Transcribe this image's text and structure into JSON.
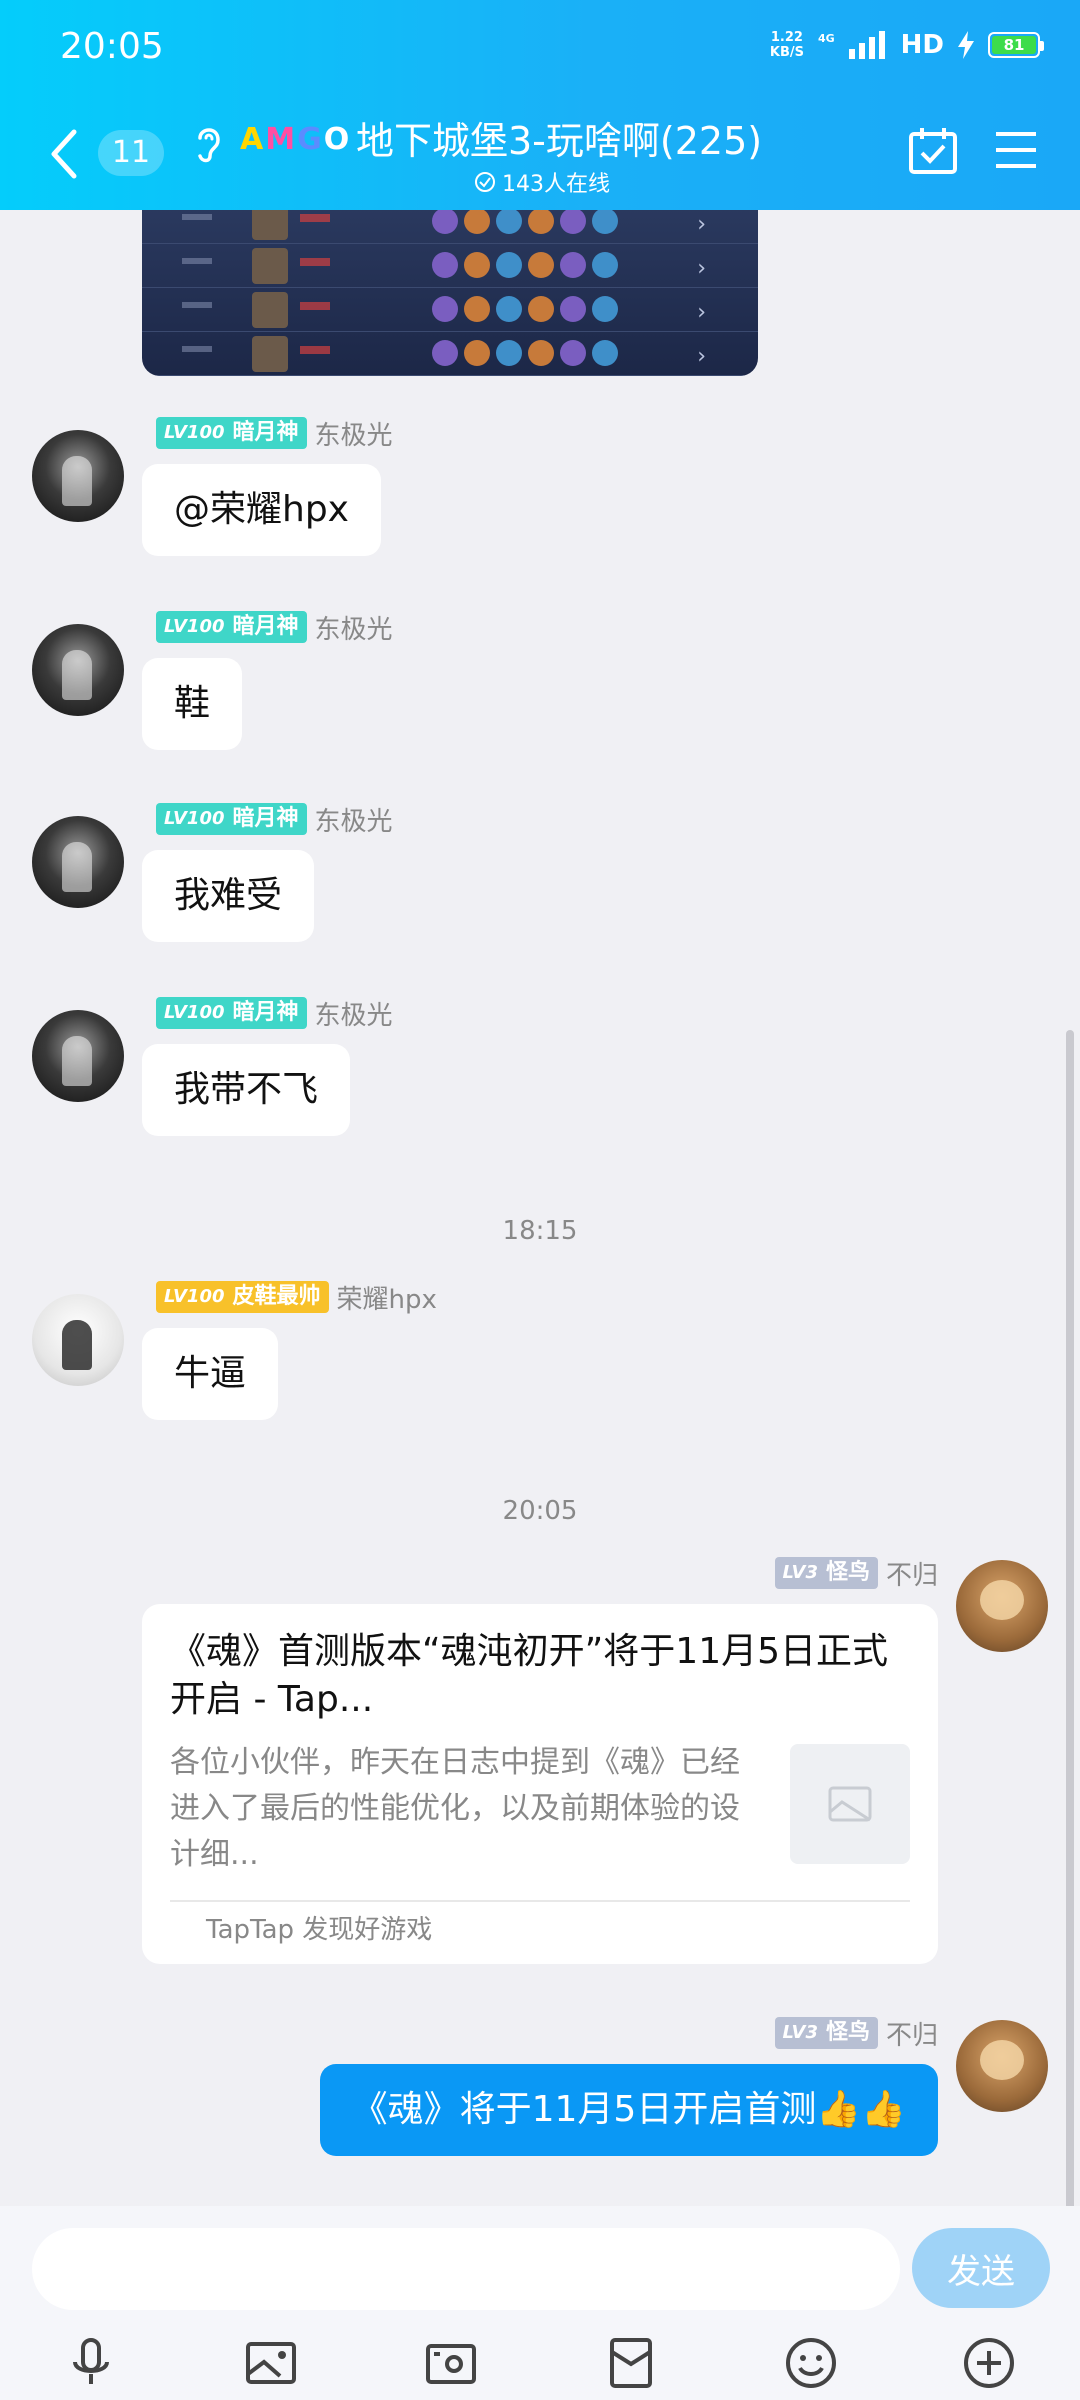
{
  "status_bar": {
    "time": "20:05",
    "net_speed_value": "1.22",
    "net_speed_unit": "KB/S",
    "network": "4G",
    "hd": "HD",
    "battery": "81"
  },
  "header": {
    "unread_count": "11",
    "group_logo": [
      "A",
      "M",
      "G",
      "O"
    ],
    "group_title": "地下城堡3-玩啥啊(225)",
    "online_text": "143人在线"
  },
  "messages": [
    {
      "level": "LV100",
      "title": "暗月神",
      "sender": "东极光",
      "text": "@荣耀hpx"
    },
    {
      "level": "LV100",
      "title": "暗月神",
      "sender": "东极光",
      "text": "鞋"
    },
    {
      "level": "LV100",
      "title": "暗月神",
      "sender": "东极光",
      "text": "我难受"
    },
    {
      "level": "LV100",
      "title": "暗月神",
      "sender": "东极光",
      "text": "我带不飞"
    },
    {
      "level": "LV100",
      "title": "皮鞋最帅",
      "sender": "荣耀hpx",
      "text": "牛逼"
    }
  ],
  "timestamps": [
    "18:15",
    "20:05"
  ],
  "link_card": {
    "level": "LV3",
    "title_tag": "怪鸟",
    "sender": "不归",
    "title": "《魂》首测版本“魂沌初开”将于11月5日正式开启 - Tap...",
    "description": "各位小伙伴，昨天在日志中提到《魂》已经进入了最后的性能优化，以及前期体验的设计细...",
    "source": "TapTap 发现好游戏"
  },
  "last_message": {
    "level": "LV3",
    "title_tag": "怪鸟",
    "sender": "不归",
    "text": "《魂》将于11月5日开启首测👍👍"
  },
  "input": {
    "value": "",
    "send_label": "发送"
  },
  "colors": {
    "header_gradient_start": "#04cdfb",
    "header_gradient_end": "#1aa8f7",
    "own_bubble": "#0a98f5",
    "tag_teal": "#3fd6c8",
    "tag_gold": "#f8c12a",
    "tag_gray": "#b7bfd3",
    "battery_green": "#3ddc4a"
  },
  "toolbar_icons": [
    "microphone-icon",
    "image-icon",
    "camera-icon",
    "red-packet-icon",
    "emoji-icon",
    "plus-icon"
  ]
}
